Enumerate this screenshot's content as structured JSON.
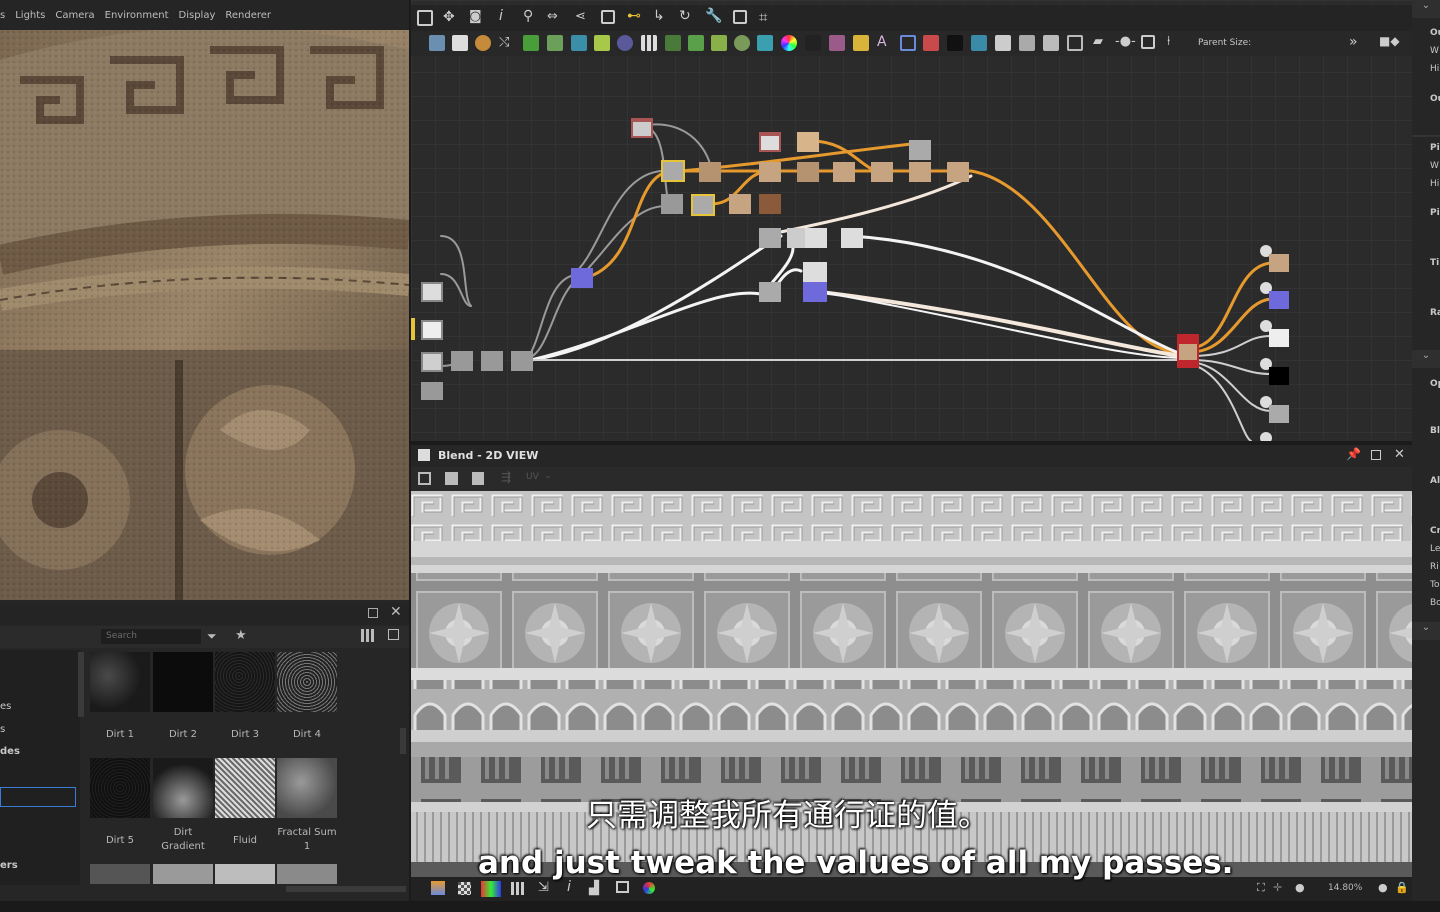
{
  "viewport": {
    "menu": [
      "s",
      "Lights",
      "Camera",
      "Environment",
      "Display",
      "Renderer"
    ]
  },
  "library": {
    "search_placeholder": "Search",
    "tree": [
      "es",
      "s",
      "des",
      "ers"
    ],
    "items": [
      {
        "label": "Dirt 1"
      },
      {
        "label": "Dirt 2"
      },
      {
        "label": "Dirt 3"
      },
      {
        "label": "Dirt 4"
      },
      {
        "label": "Dirt 5"
      },
      {
        "label": "Dirt Gradient"
      },
      {
        "label": "Fluid"
      },
      {
        "label": "Fractal Sum 1"
      }
    ]
  },
  "graph_toolbar": {
    "parent_size_label": "Parent Size:"
  },
  "view2d": {
    "title": "Blend - 2D VIEW",
    "uv_label": "UV",
    "zoom": "14.80%"
  },
  "right_panel": {
    "labels": [
      "Ou",
      "W",
      "Hi",
      "Ou",
      "Pi",
      "W",
      "Hi",
      "Pi",
      "Ti",
      "Ra",
      "Op",
      "Bl",
      "Al",
      "Cr",
      "Le",
      "Ri",
      "To",
      "Bo"
    ]
  },
  "subtitles": {
    "zh": "只需调整我所有通行证的值。",
    "en": "and just tweak the values of all my passes."
  },
  "colors": {
    "accent_orange": "#e69a2e",
    "node_red": "#c0262e",
    "node_purple": "#6f6adc"
  }
}
